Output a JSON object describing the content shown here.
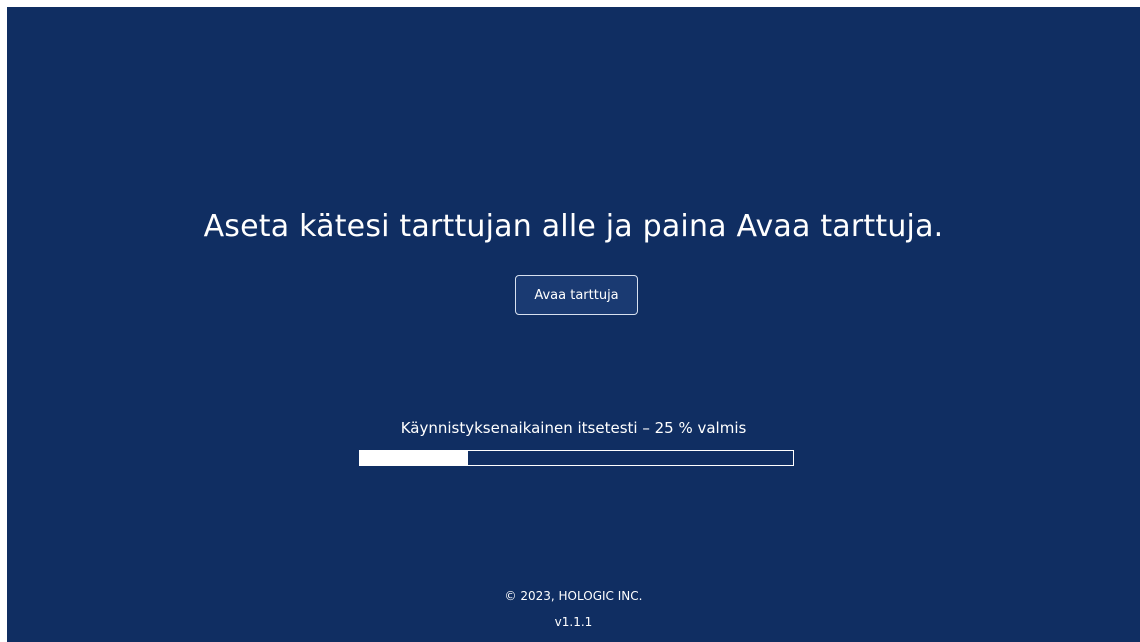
{
  "instruction": "Aseta kätesi tarttujan alle ja paina Avaa tarttuja.",
  "open_button_label": "Avaa tarttuja",
  "status": {
    "text": "Käynnistyksenaikainen itsetesti – 25 % valmis",
    "progress_percent": 25
  },
  "footer": {
    "copyright": "© 2023, HOLOGIC INC.",
    "version": "v1.1.1"
  },
  "colors": {
    "background": "#102e62",
    "text": "#ffffff"
  }
}
